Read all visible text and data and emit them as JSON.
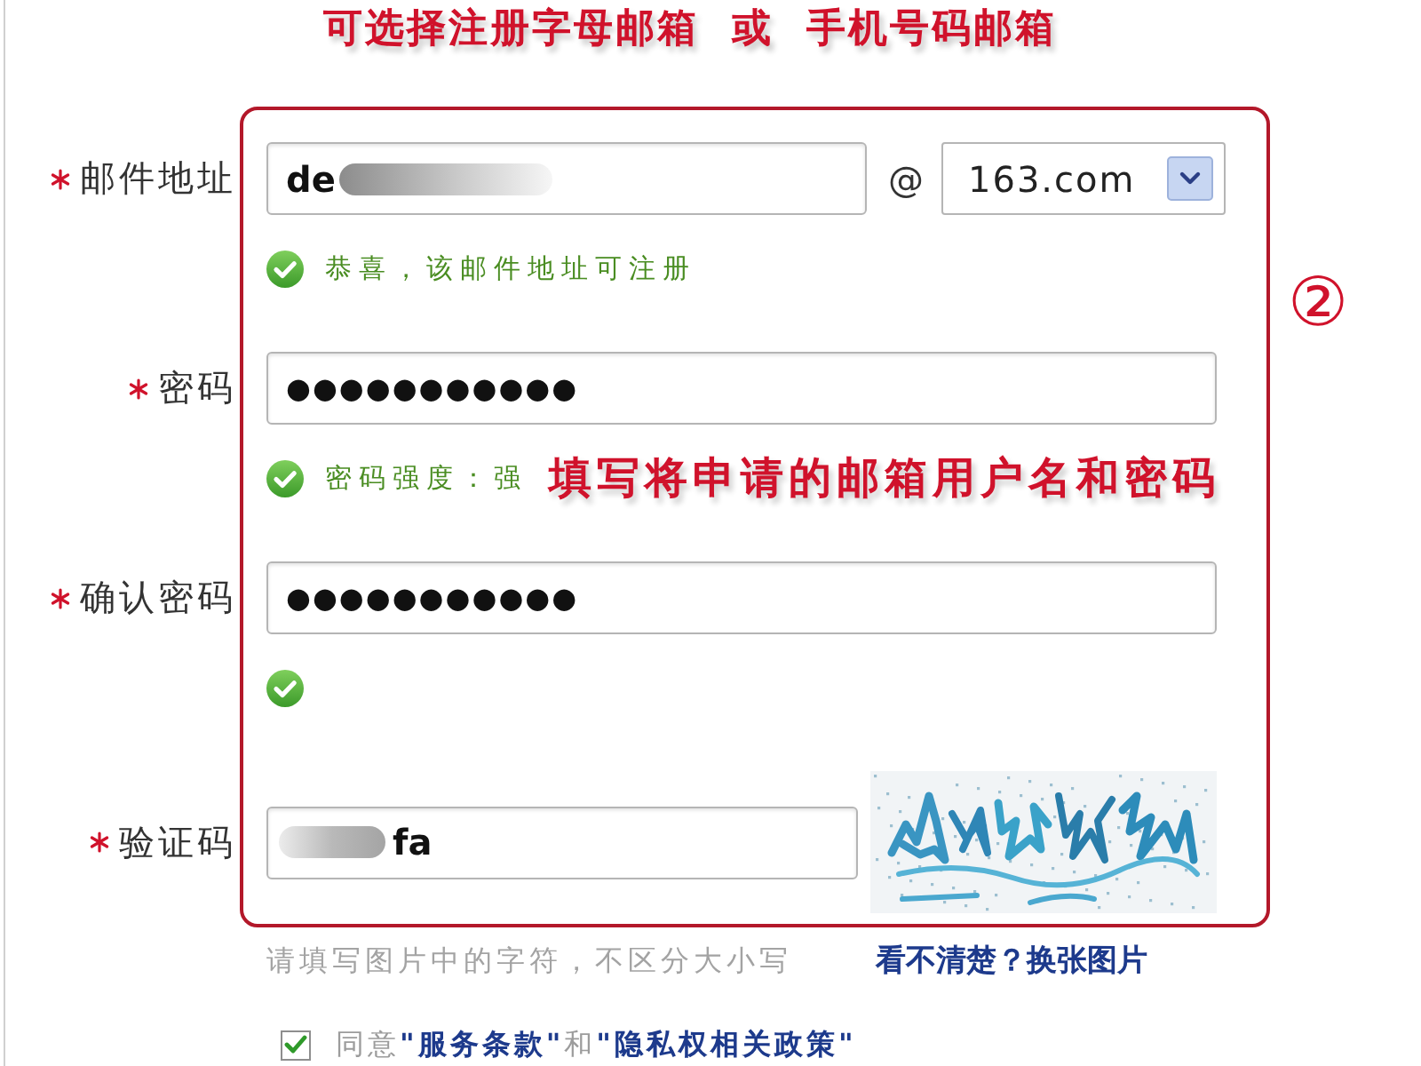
{
  "banner": {
    "title": "可选择注册字母邮箱  或  手机号码邮箱"
  },
  "step_marker": "②",
  "form": {
    "fields": [
      {
        "kind": "email",
        "label": "邮件地址",
        "required": true,
        "value_parts": [
          {
            "kind": "text",
            "text": "de"
          },
          {
            "kind": "blur"
          }
        ],
        "separator": "@",
        "domain": "163.com",
        "hint": {
          "valid": true,
          "text": "恭喜，该邮件地址可注册"
        }
      },
      {
        "kind": "password",
        "label": "密码",
        "required": true,
        "value_parts": [
          {
            "kind": "text",
            "text": "●●●●●●●●●●●"
          }
        ],
        "hint": {
          "valid": true,
          "text": "密码强度：强",
          "annotation": "填写将申请的邮箱用户名和密码"
        }
      },
      {
        "kind": "password",
        "label": "确认密码",
        "required": true,
        "value_parts": [
          {
            "kind": "text",
            "text": "●●●●●●●●●●●"
          }
        ],
        "hint": {
          "valid": true
        }
      },
      {
        "kind": "captcha",
        "label": "验证码",
        "required": true,
        "value_parts": [
          {
            "kind": "blur"
          },
          {
            "kind": "text",
            "text": "fa"
          }
        ]
      }
    ]
  },
  "captcha_help": {
    "text": "请填写图片中的字符，不区分大小写",
    "refresh_link": "看不清楚？换张图片"
  },
  "agreement": {
    "checked": true,
    "parts": [
      {
        "kind": "text",
        "text": "同意"
      },
      {
        "kind": "link",
        "text": "\"服务条款\""
      },
      {
        "kind": "text",
        "text": "和"
      },
      {
        "kind": "link",
        "text": "\"隐私权相关政策\""
      }
    ]
  }
}
